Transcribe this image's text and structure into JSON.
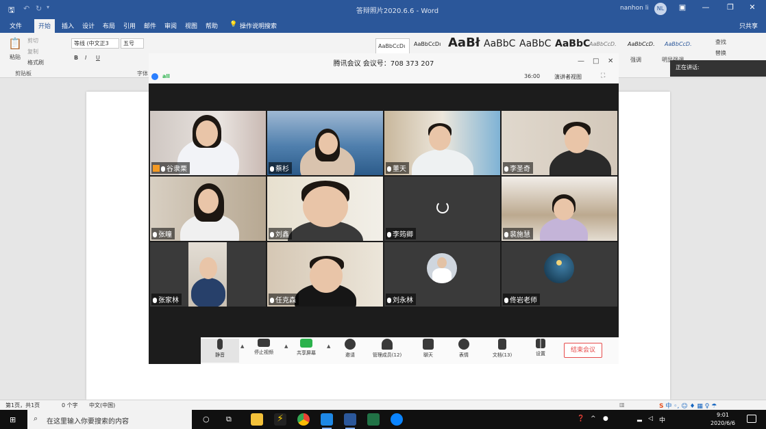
{
  "word": {
    "title": "答辩照片2020.6.6 - Word",
    "user_name": "nanhon li",
    "user_initials": "NL",
    "share_label": "只共享",
    "window_buttons": [
      "—",
      "❐",
      "✕",
      "▣"
    ],
    "tabs": [
      "文件",
      "开始",
      "插入",
      "设计",
      "布局",
      "引用",
      "邮件",
      "审阅",
      "视图",
      "帮助",
      "操作说明搜索"
    ],
    "active_tab": "开始",
    "ribbon": {
      "paste": "粘贴",
      "cut": "剪切",
      "copy": "复制",
      "format_painter": "格式刷",
      "clipboard_group": "剪贴板",
      "font_name": "等线 (中文正3",
      "font_size": "五号",
      "font_group": "字体",
      "bold": "B",
      "italic": "I",
      "underline": "U",
      "style_samples": [
        "AaBbCcDı",
        "AaBbCcDı",
        "AaBł",
        "AaBbC",
        "AaBbC",
        "AaBbC",
        "AaBbCcD.",
        "AaBbCcD.",
        "AaBbCcD."
      ],
      "style_labels": [
        "强调",
        "明显强调"
      ],
      "find": "查找",
      "replace": "替换"
    },
    "status": {
      "page": "第1页，共1页",
      "words": "0 个字",
      "language": "中文(中国)"
    },
    "ime": "中 ◦, ☺ ♦ ▦ ♀ ☂"
  },
  "meeting": {
    "title": "腾讯会议 会议号：708 373 207",
    "timer": "36:00",
    "speaker_view": "演讲者视图",
    "signal": "all",
    "window_controls": [
      "—",
      "□",
      "✕"
    ],
    "expand_icon": "⛶",
    "participants": [
      {
        "name": "谷隶栗",
        "host": true
      },
      {
        "name": "蔡杉"
      },
      {
        "name": "董天"
      },
      {
        "name": "李圣奇"
      },
      {
        "name": "张瞳"
      },
      {
        "name": "刘鑫"
      },
      {
        "name": "李筠卿"
      },
      {
        "name": "裴施慧"
      },
      {
        "name": "张家林"
      },
      {
        "name": "任克森"
      },
      {
        "name": "刘永林"
      },
      {
        "name": "佟岩老师"
      }
    ],
    "toolbar": {
      "mute": "静音",
      "stop_video": "停止视频",
      "share_screen": "共享屏幕",
      "invite": "邀请",
      "manage": "管理成员(12)",
      "chat": "聊天",
      "reactions": "表情",
      "docs": "文档(13)",
      "settings": "设置",
      "end": "结束会议"
    },
    "speaking": "正在讲话:"
  },
  "taskbar": {
    "search_placeholder": "在这里输入你要搜索的内容",
    "time": "9:01",
    "date": "2020/6/6",
    "tray_lang": "中"
  },
  "colors": {
    "word_blue": "#2b579a",
    "end_red": "#e64b4b",
    "host_orange": "#f59a23"
  }
}
